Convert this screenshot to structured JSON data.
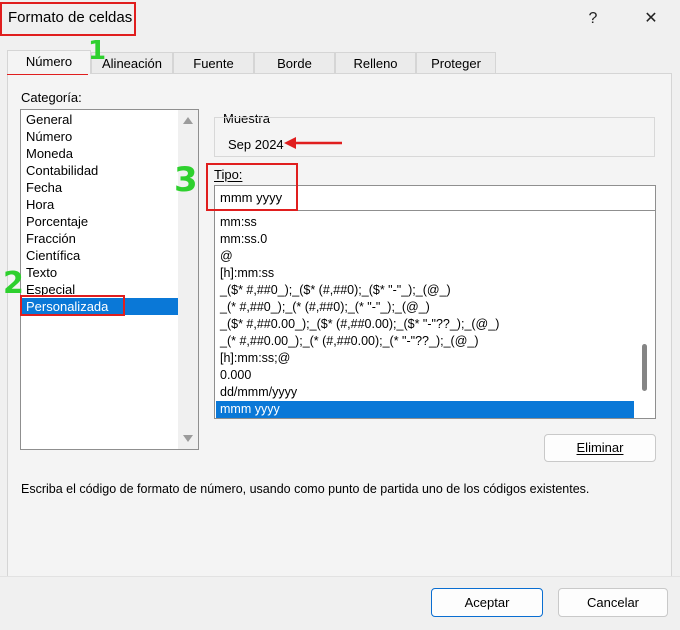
{
  "window": {
    "title": "Formato de celdas",
    "help": "?",
    "close": "✕"
  },
  "tabs": [
    "Número",
    "Alineación",
    "Fuente",
    "Borde",
    "Relleno",
    "Proteger"
  ],
  "category_label": "Categoría:",
  "categories": [
    "General",
    "Número",
    "Moneda",
    "Contabilidad",
    "Fecha",
    "Hora",
    "Porcentaje",
    "Fracción",
    "Científica",
    "Texto",
    "Especial",
    "Personalizada"
  ],
  "selected_category": "Personalizada",
  "sample": {
    "label": "Muestra",
    "value": "Sep 2024"
  },
  "type": {
    "label": "Tipo:",
    "value": "mmm yyyy"
  },
  "format_codes": [
    "mm:ss",
    "mm:ss.0",
    "@",
    "[h]:mm:ss",
    "_($* #,##0_);_($* (#,##0);_($* \"-\"_);_(@_)",
    "_(* #,##0_);_(* (#,##0);_(* \"-\"_);_(@_)",
    "_($* #,##0.00_);_($* (#,##0.00);_($* \"-\"??_);_(@_)",
    "_(* #,##0.00_);_(* (#,##0.00);_(* \"-\"??_);_(@_)",
    "[h]:mm:ss;@",
    "0.000",
    "dd/mmm/yyyy",
    "mmm yyyy"
  ],
  "buttons": {
    "delete": "Eliminar",
    "ok": "Aceptar",
    "cancel": "Cancelar"
  },
  "hint": "Escriba el código de formato de número, usando como punto de partida uno de los códigos existentes.",
  "annotations": [
    "1",
    "2",
    "3"
  ],
  "colors": {
    "accent": "#0a78d7",
    "highlight": "#e01e1e",
    "annotation": "#2ed02e"
  }
}
